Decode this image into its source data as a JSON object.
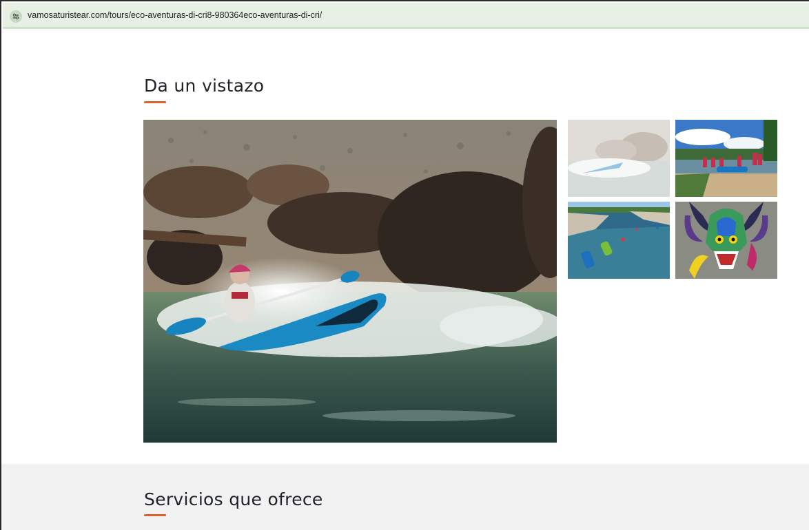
{
  "browser": {
    "url": "vamosaturistear.com/tours/eco-aventuras-di-cri8-980364eco-aventuras-di-cri/"
  },
  "gallery": {
    "title": "Da un vistazo",
    "images": [
      {
        "name": "kayak-whitewater-main"
      },
      {
        "name": "kayak-rapids-thumb"
      },
      {
        "name": "group-riverbank-thumb"
      },
      {
        "name": "river-kayaks-thumb"
      },
      {
        "name": "diablito-mask-thumb"
      }
    ]
  },
  "services": {
    "title": "Servicios que ofrece"
  },
  "colors": {
    "accent": "#e0622a",
    "urlbar": "#e8f0e6",
    "band": "#f2f2f2"
  }
}
